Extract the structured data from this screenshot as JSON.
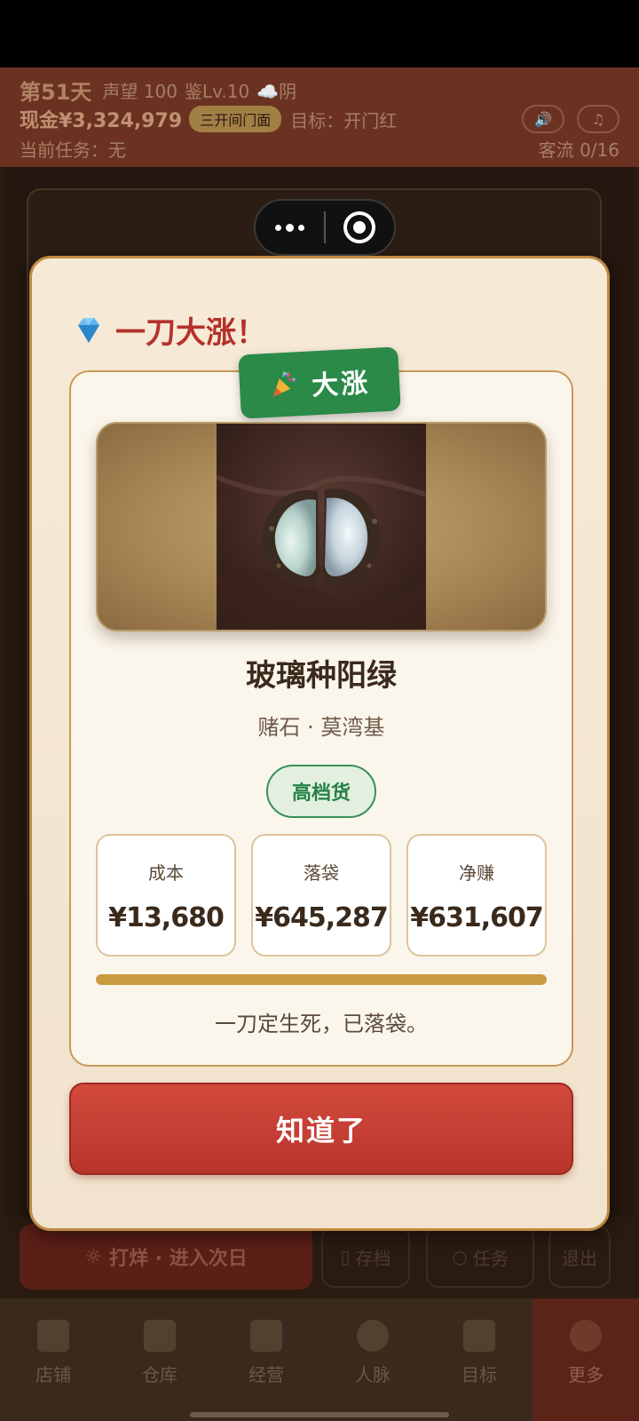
{
  "game_header": {
    "day": "第51天",
    "reputation": "声望 100",
    "level": "鉴Lv.10",
    "weather": "☁️阴",
    "cash": "现金¥3,324,979",
    "store_type": "三开间门面",
    "goal": "目标：开门红",
    "task": "当前任务：无",
    "traffic": "客流 0/16",
    "sound_icon": "speaker-icon",
    "music_icon": "music-icon"
  },
  "action_bar": {
    "next_day": "打烊 · 进入次日",
    "save": "存档",
    "tasks": "任务",
    "exit": "退出"
  },
  "tabs": [
    {
      "label": "店铺",
      "icon": "shop-icon"
    },
    {
      "label": "仓库",
      "icon": "warehouse-icon"
    },
    {
      "label": "经营",
      "icon": "ledger-icon"
    },
    {
      "label": "人脉",
      "icon": "people-icon"
    },
    {
      "label": "目标",
      "icon": "goal-icon"
    },
    {
      "label": "更多",
      "icon": "more-icon"
    }
  ],
  "active_tab": "更多",
  "modal": {
    "title_icon": "gem-icon",
    "title": "一刀大涨！",
    "badge_icon": "party-popper-icon",
    "badge": "大涨",
    "item_name": "玻璃种阳绿",
    "item_sub": "赌石 · 莫湾基",
    "grade": "高档货",
    "stats": [
      {
        "label": "成本",
        "value": "¥13,680"
      },
      {
        "label": "落袋",
        "value": "¥645,287"
      },
      {
        "label": "净赚",
        "value": "¥631,607"
      }
    ],
    "progress": 1.0,
    "note": "一刀定生死，已落袋。",
    "confirm": "知道了"
  },
  "colors": {
    "accent_red": "#b5312a",
    "badge_green": "#2b8a48",
    "gold": "#c99a3f"
  }
}
